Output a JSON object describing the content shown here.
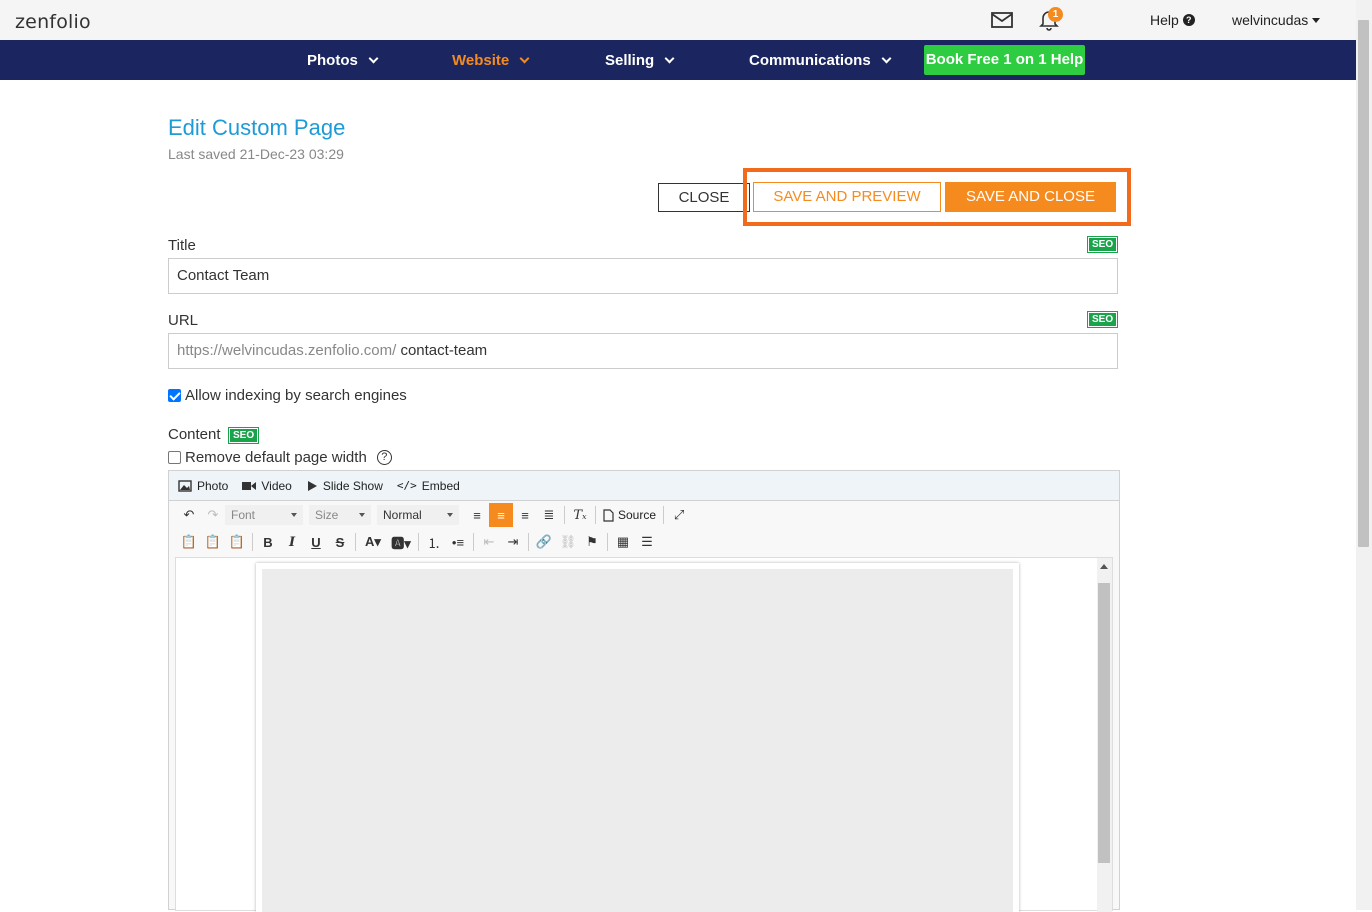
{
  "header": {
    "logo": "zenfolio",
    "notification_count": "1",
    "help_label": "Help",
    "username": "welvincudas"
  },
  "nav": {
    "items": [
      {
        "label": "Photos"
      },
      {
        "label": "Website"
      },
      {
        "label": "Selling"
      },
      {
        "label": "Communications"
      }
    ],
    "active": "Website",
    "book_help_label": "Book Free 1 on 1 Help"
  },
  "page": {
    "title": "Edit Custom Page",
    "last_saved": "Last saved  21-Dec-23 03:29"
  },
  "actions": {
    "close_label": "CLOSE",
    "save_preview_label": "SAVE AND PREVIEW",
    "save_close_label": "SAVE AND CLOSE"
  },
  "form": {
    "title_label": "Title",
    "title_value": "Contact Team",
    "url_label": "URL",
    "url_prefix": "https://welvincudas.zenfolio.com/",
    "url_value": "contact-team",
    "seo_badge": "SEO",
    "allow_indexing_label": "Allow indexing by search engines",
    "allow_indexing_checked": true,
    "content_label": "Content",
    "remove_width_label": "Remove default page width",
    "remove_width_checked": false
  },
  "editor": {
    "media_buttons": [
      "Photo",
      "Video",
      "Slide Show",
      "Embed"
    ],
    "font_placeholder": "Font",
    "size_placeholder": "Size",
    "format_value": "Normal",
    "source_label": "Source"
  },
  "colors": {
    "nav_bg": "#1b2661",
    "accent_orange": "#f58b1f",
    "highlight_orange": "#f26a1b",
    "link_blue": "#1e9bd7",
    "seo_green": "#1aa34a",
    "book_green": "#2ecc40"
  }
}
